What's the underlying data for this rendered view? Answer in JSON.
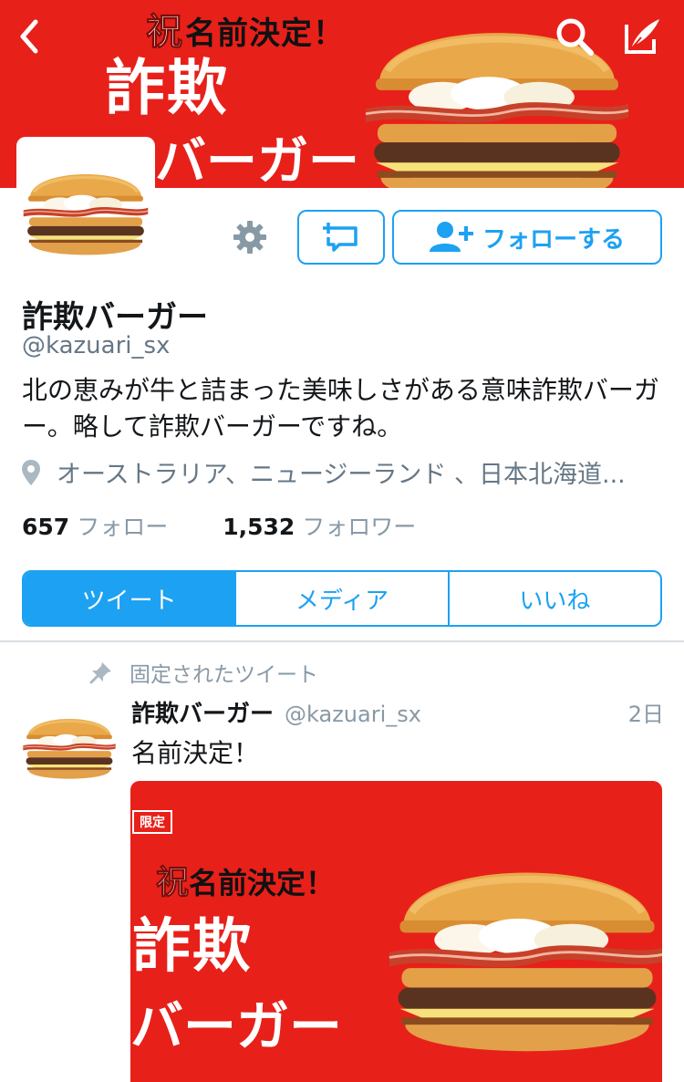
{
  "header": {
    "banner_tag_prefix": "祝",
    "banner_tag": "名前決定！",
    "banner_title_line1": "詐欺",
    "banner_title_line2": "バーガー",
    "back_icon": "chevron-left-icon",
    "search_icon": "search-icon",
    "compose_icon": "compose-icon"
  },
  "profile": {
    "follow_label": "フォローする",
    "display_name": "詐欺バーガー",
    "handle": "@kazuari_sx",
    "bio": "北の恵みが牛と詰まった美味しさがある意味詐欺バーガー。略して詐欺バーガーですね。",
    "location": "オーストラリア、ニュージーランド 、日本北海道...",
    "following_count": "657",
    "following_label": "フォロー",
    "followers_count": "1,532",
    "followers_label": "フォロワー"
  },
  "tabs": [
    {
      "label": "ツイート",
      "active": true
    },
    {
      "label": "メディア",
      "active": false
    },
    {
      "label": "いいね",
      "active": false
    }
  ],
  "pinned_tweet": {
    "pinned_label": "固定されたツイート",
    "name": "詐欺バーガー",
    "handle": "@kazuari_sx",
    "time": "2日",
    "text": "名前決定！",
    "media": {
      "badge": "限定",
      "tag_prefix": "祝",
      "tag": "名前決定！",
      "title_line1": "詐欺",
      "title_line2": "バーガー"
    }
  },
  "colors": {
    "accent": "#1da1f2",
    "banner_red": "#e8201a",
    "muted_text": "#8899a6"
  }
}
